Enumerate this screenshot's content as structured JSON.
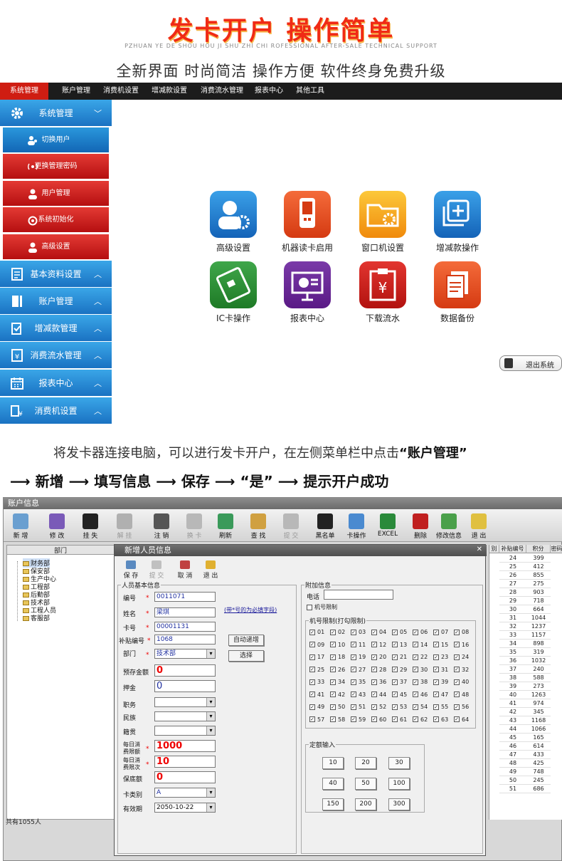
{
  "banner": {
    "title": "发卡开户 操作简单",
    "subtitle": "PZHUAN YE DE SHOU HOU JI SHU ZHI CHI ROFESSIONAL AFTER-SALE TECHNICAL SUPPORT",
    "slogan": "全新界面 时尚简洁 操作方便 软件终身免费升级"
  },
  "topnav": [
    "系统管理",
    "账户管理",
    "消费机设置",
    "增减款设置",
    "消费流水管理",
    "报表中心",
    "其他工具"
  ],
  "sidebar": {
    "system": "系统管理",
    "sub": [
      "切换用户",
      "更换管理密码",
      "用户管理",
      "系统初始化",
      "高级设置"
    ],
    "groups": [
      "基本资料设置",
      "账户管理",
      "增减款管理",
      "消费流水管理",
      "报表中心",
      "消费机设置"
    ]
  },
  "apps": [
    "高级设置",
    "机器读卡启用",
    "窗口机设置",
    "增减款操作",
    "IC卡操作",
    "报表中心",
    "下载流水",
    "数据备份"
  ],
  "exit_label": "退出系统",
  "instruction": {
    "line1_a": "将发卡器连接电脑，可以进行发卡开户，在左侧菜单栏中点击",
    "line1_b": "“账户管理”",
    "steps": [
      "新增",
      "填写信息",
      "保存",
      "“是”",
      "提示开户成功"
    ]
  },
  "window": {
    "title": "账户信息",
    "toolbar": [
      "新 增",
      "修 改",
      "挂 失",
      "解 挂",
      "注 销",
      "换 卡",
      "刷新",
      "查 找",
      "提 交",
      "黑名单",
      "卡操作",
      "EXCEL",
      "删除",
      "修改信息",
      "退 出"
    ],
    "tree_header": "部门",
    "tree": [
      "财务部",
      "保安部",
      "生产中心",
      "工程部",
      "后勤部",
      "技术部",
      "工程人员",
      "客服部"
    ],
    "count": "共有1055人",
    "grid_headers": [
      "别",
      "补贴编号",
      "积分",
      "密码"
    ],
    "grid_rows": [
      [
        "24",
        "399"
      ],
      [
        "25",
        "412"
      ],
      [
        "26",
        "855"
      ],
      [
        "27",
        "275"
      ],
      [
        "28",
        "903"
      ],
      [
        "29",
        "718"
      ],
      [
        "30",
        "664"
      ],
      [
        "31",
        "1044"
      ],
      [
        "32",
        "1237"
      ],
      [
        "33",
        "1157"
      ],
      [
        "34",
        "898"
      ],
      [
        "35",
        "319"
      ],
      [
        "36",
        "1032"
      ],
      [
        "37",
        "240"
      ],
      [
        "38",
        "588"
      ],
      [
        "39",
        "273"
      ],
      [
        "40",
        "1263"
      ],
      [
        "41",
        "974"
      ],
      [
        "42",
        "345"
      ],
      [
        "43",
        "1168"
      ],
      [
        "44",
        "1066"
      ],
      [
        "45",
        "165"
      ],
      [
        "46",
        "614"
      ],
      [
        "47",
        "433"
      ],
      [
        "48",
        "425"
      ],
      [
        "49",
        "748"
      ],
      [
        "50",
        "245"
      ],
      [
        "51",
        "686"
      ]
    ]
  },
  "dialog": {
    "title": "新增人员信息",
    "close": "✕",
    "toolbar": [
      "保 存",
      "提 交",
      "取 消",
      "退 出"
    ],
    "basic_title": "人员基本信息",
    "fields": {
      "bianhao": {
        "label": "编号",
        "value": "0011071"
      },
      "name": {
        "label": "姓名",
        "value": "梁琪"
      },
      "card": {
        "label": "卡号",
        "value": "00001131"
      },
      "subsidy": {
        "label": "补贴编号",
        "value": "1068"
      },
      "dept": {
        "label": "部门",
        "value": "技术部"
      },
      "deposit": {
        "label": "预存金额",
        "value": "0"
      },
      "pledge": {
        "label": "押金",
        "value": "0"
      },
      "job": {
        "label": "职务",
        "value": ""
      },
      "nation": {
        "label": "民族",
        "value": ""
      },
      "native": {
        "label": "籍贯",
        "value": ""
      },
      "daily_limit": {
        "label": "每日消费限额",
        "value": "1000"
      },
      "daily_times": {
        "label": "每日消费限次",
        "value": "10"
      },
      "floor": {
        "label": "保底额",
        "value": "0"
      },
      "card_type": {
        "label": "卡类别",
        "value": "A"
      },
      "expiry": {
        "label": "有效期",
        "value": "2050-10-22"
      }
    },
    "required_note": "(带*号的为必填字段)",
    "auto_inc": "自动递增",
    "choose": "选择",
    "extra_title": "附加信息",
    "phone_label": "电话",
    "machine_limit": "机号限制",
    "machine_group": "机号限制(打勾限制)",
    "machines": [
      "01",
      "02",
      "03",
      "04",
      "05",
      "06",
      "07",
      "08",
      "09",
      "10",
      "11",
      "12",
      "13",
      "14",
      "15",
      "16",
      "17",
      "18",
      "19",
      "20",
      "21",
      "22",
      "23",
      "24",
      "25",
      "26",
      "27",
      "28",
      "29",
      "30",
      "31",
      "32",
      "33",
      "34",
      "35",
      "36",
      "37",
      "38",
      "39",
      "40",
      "41",
      "42",
      "43",
      "44",
      "45",
      "46",
      "47",
      "48",
      "49",
      "50",
      "51",
      "52",
      "53",
      "54",
      "55",
      "56",
      "57",
      "58",
      "59",
      "60",
      "61",
      "62",
      "63",
      "64"
    ],
    "quota_title": "定额输入",
    "quotas": [
      "10",
      "20",
      "30",
      "40",
      "50",
      "100",
      "150",
      "200",
      "300"
    ]
  },
  "colors": {
    "accent_red": "#f02a15",
    "sidebar_blue": "#1a72c2",
    "sidebar_red": "#c21a15"
  }
}
